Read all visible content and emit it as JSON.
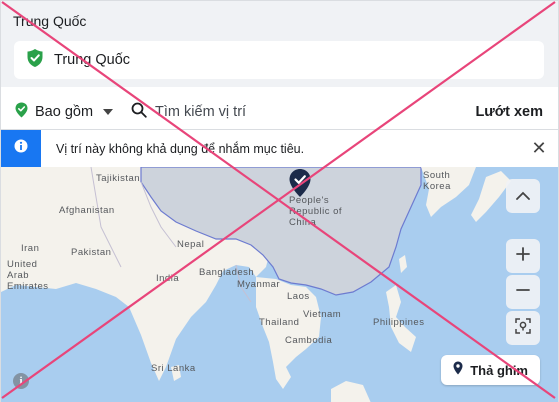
{
  "location": {
    "title": "Trung Quốc",
    "selected": "Trung Quốc"
  },
  "toolbar": {
    "include_label": "Bao gồm",
    "search_placeholder": "Tìm kiếm vị trí",
    "browse_label": "Lướt xem"
  },
  "banner": {
    "message": "Vị trí này không khả dụng để nhắm mục tiêu."
  },
  "map": {
    "labels": {
      "tajikistan": "Tajikistan",
      "afghanistan": "Afghanistan",
      "pakistan": "Pakistan",
      "uae": "United Arab Emirates",
      "iran": "Iran",
      "nepal": "Nepal",
      "india": "India",
      "bangladesh": "Bangladesh",
      "myanmar": "Myanmar",
      "laos": "Laos",
      "thailand": "Thailand",
      "vietnam": "Vietnam",
      "cambodia": "Cambodia",
      "sri_lanka": "Sri Lanka",
      "china": "People's Republic of China",
      "south_korea": "South Korea",
      "philippines": "Philippines"
    },
    "pin_button_label": "Thả ghim",
    "pin_color": "#1c2b4a",
    "accent": "#1877f2",
    "check_green": "#2aa14a",
    "overlay_color": "#e8457a"
  }
}
